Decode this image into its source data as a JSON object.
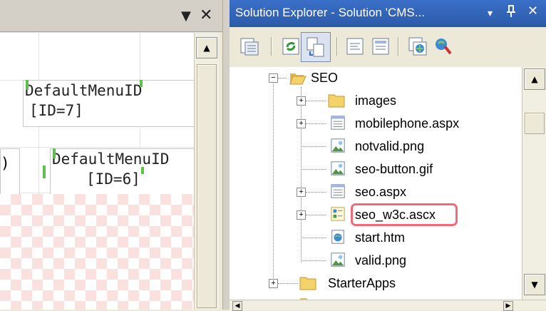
{
  "left_pane": {
    "controls": {
      "dropdown_icon": "chevron-down-icon",
      "close_icon": "close-icon"
    },
    "menu_items": [
      {
        "name": "DefaultMenuID",
        "id_label": "[ID=7]"
      },
      {
        "name": "DefaultMenuID",
        "id_label": "[ID=6]"
      }
    ],
    "partial_text": ")"
  },
  "solution_explorer": {
    "title": "Solution Explorer - Solution 'CMS...",
    "buttons": {
      "dropdown": "▾",
      "pin": "ᵻ",
      "close": "✕"
    },
    "toolbar": [
      "properties-icon",
      "refresh-icon",
      "nest-related-files-icon",
      "view-code-icon",
      "view-designer-icon",
      "copy-website-icon",
      "aspnet-configuration-icon"
    ],
    "tree": [
      {
        "label": "SEO",
        "icon": "folder-open-icon",
        "expander": "−"
      },
      {
        "label": "images",
        "icon": "folder-icon",
        "expander": "+"
      },
      {
        "label": "mobilephone.aspx",
        "icon": "aspx-icon",
        "expander": "+"
      },
      {
        "label": "notvalid.png",
        "icon": "image-file-icon",
        "expander": ""
      },
      {
        "label": "seo-button.gif",
        "icon": "image-file-icon",
        "expander": ""
      },
      {
        "label": "seo.aspx",
        "icon": "aspx-icon",
        "expander": "+"
      },
      {
        "label": "seo_w3c.ascx",
        "icon": "user-control-icon",
        "expander": "+",
        "highlighted": true
      },
      {
        "label": "start.htm",
        "icon": "html-file-icon",
        "expander": ""
      },
      {
        "label": "valid.png",
        "icon": "image-file-icon",
        "expander": ""
      },
      {
        "label": "StarterApps",
        "icon": "folder-icon",
        "expander": "+"
      }
    ]
  },
  "colors": {
    "title_bar": "#2c5aa8",
    "highlight_border": "#f06a78",
    "design_checker": "#fbe0e0",
    "folder_yellow": "#f3d26a"
  }
}
